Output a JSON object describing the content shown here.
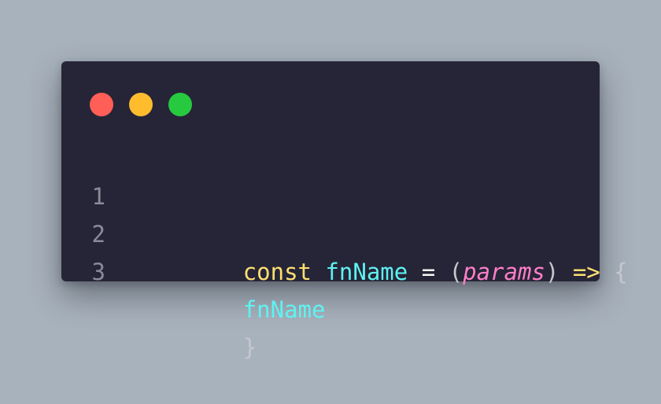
{
  "colors": {
    "background": "#a8b2bc",
    "window": "#262537",
    "dot_red": "#ff5f56",
    "dot_yellow": "#ffbd2e",
    "dot_green": "#27c93f",
    "keyword": "#ffe071",
    "identifier": "#5ff2f2",
    "operator": "#f8f8f2",
    "punctuation": "#c7c6cf",
    "param": "#ff7ec8",
    "arrow": "#ffe071",
    "line_number": "#8b8a99"
  },
  "window_controls": {
    "close_icon": "red-circle",
    "minimize_icon": "yellow-circle",
    "maximize_icon": "green-circle"
  },
  "code": {
    "lines": [
      {
        "number": "1",
        "tokens": [
          {
            "text": "const",
            "role": "keyword"
          },
          {
            "text": " ",
            "role": "space"
          },
          {
            "text": "fnName",
            "role": "identifier"
          },
          {
            "text": " ",
            "role": "space"
          },
          {
            "text": "=",
            "role": "operator"
          },
          {
            "text": " ",
            "role": "space"
          },
          {
            "text": "(",
            "role": "punctuation"
          },
          {
            "text": "params",
            "role": "param"
          },
          {
            "text": ")",
            "role": "punctuation"
          },
          {
            "text": " ",
            "role": "space"
          },
          {
            "text": "=>",
            "role": "arrow"
          },
          {
            "text": " ",
            "role": "space"
          },
          {
            "text": "{",
            "role": "punctuation"
          }
        ]
      },
      {
        "number": "2",
        "tokens": [
          {
            "text": "fnName",
            "role": "identifier"
          }
        ]
      },
      {
        "number": "3",
        "tokens": [
          {
            "text": "}",
            "role": "punctuation"
          }
        ]
      }
    ]
  }
}
